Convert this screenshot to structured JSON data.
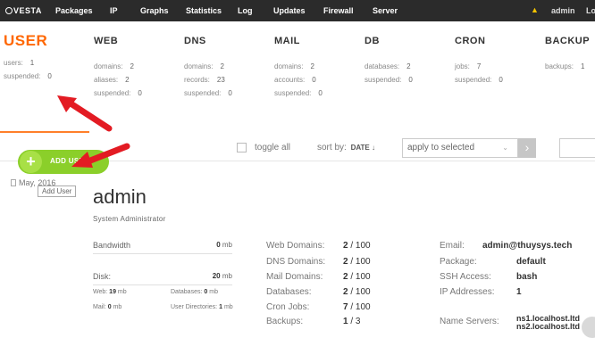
{
  "topbar": {
    "logo": "VESTA",
    "nav": [
      "Packages",
      "IP",
      "Graphs",
      "Statistics",
      "Log",
      "Updates",
      "Firewall",
      "Server"
    ],
    "user": "admin",
    "logout": "Lo"
  },
  "stats": {
    "user": {
      "title": "USER",
      "rows": [
        {
          "k": "users:",
          "v": "1"
        },
        {
          "k": "suspended:",
          "v": "0"
        }
      ]
    },
    "web": {
      "title": "WEB",
      "rows": [
        {
          "k": "domains:",
          "v": "2"
        },
        {
          "k": "aliases:",
          "v": "2"
        },
        {
          "k": "suspended:",
          "v": "0"
        }
      ]
    },
    "dns": {
      "title": "DNS",
      "rows": [
        {
          "k": "domains:",
          "v": "2"
        },
        {
          "k": "records:",
          "v": "23"
        },
        {
          "k": "suspended:",
          "v": "0"
        }
      ]
    },
    "mail": {
      "title": "MAIL",
      "rows": [
        {
          "k": "domains:",
          "v": "2"
        },
        {
          "k": "accounts:",
          "v": "0"
        },
        {
          "k": "suspended:",
          "v": "0"
        }
      ]
    },
    "db": {
      "title": "DB",
      "rows": [
        {
          "k": "databases:",
          "v": "2"
        },
        {
          "k": "suspended:",
          "v": "0"
        }
      ]
    },
    "cron": {
      "title": "CRON",
      "rows": [
        {
          "k": "jobs:",
          "v": "7"
        },
        {
          "k": "suspended:",
          "v": "0"
        }
      ]
    },
    "backup": {
      "title": "BACKUP",
      "rows": [
        {
          "k": "backups:",
          "v": "1"
        }
      ]
    }
  },
  "toolbar": {
    "toggle_all": "toggle all",
    "sort_by": "sort by:",
    "sort_value": "DATE ↓",
    "apply_selected": "apply to selected",
    "go": "›"
  },
  "add_user": {
    "label": "ADD USER",
    "tooltip": "Add User"
  },
  "record": {
    "date": "May, 2016",
    "username": "admin",
    "role": "System Administrator",
    "bandwidth_label": "Bandwidth",
    "bandwidth_value": "0",
    "bandwidth_unit": "mb",
    "disk_label": "Disk:",
    "disk_value": "20",
    "disk_unit": "mb",
    "disk_web_label": "Web:",
    "disk_web_value": "19",
    "disk_mail_label": "Mail:",
    "disk_mail_value": "0",
    "disk_db_label": "Databases:",
    "disk_db_value": "0",
    "disk_dirs_label": "User Directories:",
    "disk_dirs_value": "1",
    "mb": "mb",
    "counts": [
      {
        "k": "Web Domains:",
        "used": "2",
        "total": "/ 100"
      },
      {
        "k": "DNS Domains:",
        "used": "2",
        "total": "/ 100"
      },
      {
        "k": "Mail Domains:",
        "used": "2",
        "total": "/ 100"
      },
      {
        "k": "Databases:",
        "used": "2",
        "total": "/ 100"
      },
      {
        "k": "Cron Jobs:",
        "used": "7",
        "total": "/ 100"
      },
      {
        "k": "Backups:",
        "used": "1",
        "total": "/ 3"
      }
    ],
    "info": [
      {
        "k": "Email:",
        "v": "admin@thuysys.tech"
      },
      {
        "k": "Package:",
        "v": "default"
      },
      {
        "k": "SSH Access:",
        "v": "bash"
      },
      {
        "k": "IP Addresses:",
        "v": "1"
      }
    ],
    "ns_label": "Name Servers:",
    "ns1": "ns1.localhost.ltd",
    "ns2": "ns2.localhost.ltd"
  },
  "colors": {
    "accent": "#ff6701",
    "add_button": "#8bcf2a",
    "arrow": "#e31b23",
    "topbar": "#2b2b2b"
  }
}
